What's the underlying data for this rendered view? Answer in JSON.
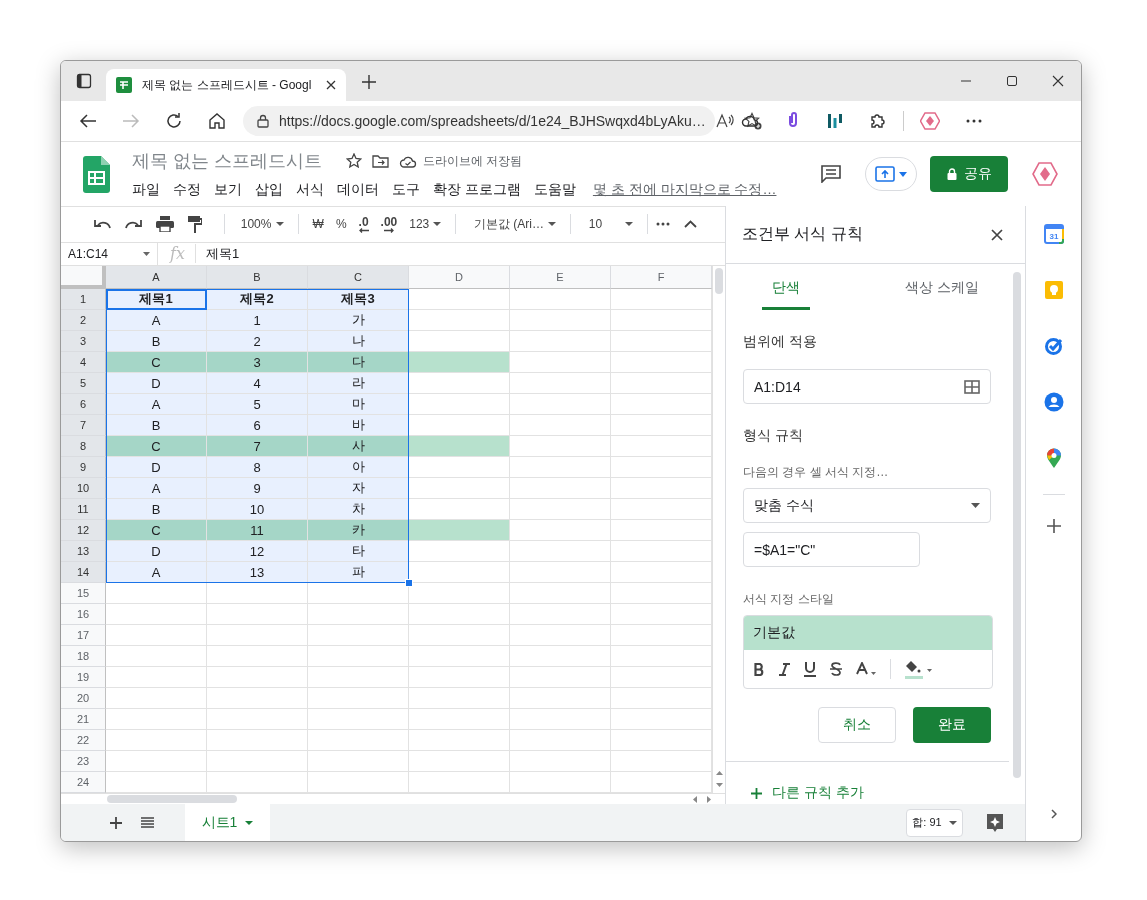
{
  "browser": {
    "tab_title": "제목 없는 스프레드시트 - Googl",
    "url": "https://docs.google.com/spreadsheets/d/1e24_BJHSwqxd4bLyAku…"
  },
  "app": {
    "doc_title": "제목 없는 스프레드시트",
    "save_status": "드라이브에 저장됨",
    "menu": [
      "파일",
      "수정",
      "보기",
      "삽입",
      "서식",
      "데이터",
      "도구",
      "확장 프로그램",
      "도움말"
    ],
    "last_edit": "몇 초 전에 마지막으로 수정…",
    "share_label": "공유"
  },
  "toolbar": {
    "zoom": "100%",
    "currency": "₩",
    "percent": "%",
    "decrease_decimal": ".0",
    "increase_decimal": ".00",
    "number_format": "123",
    "font": "기본값 (Ari…",
    "font_size": "10"
  },
  "formula_bar": {
    "name_box": "A1:C14",
    "fx": "fx",
    "content": "제목1"
  },
  "grid": {
    "columns": [
      {
        "label": "A",
        "selected": true,
        "in_rule": true
      },
      {
        "label": "B",
        "selected": true,
        "in_rule": true
      },
      {
        "label": "C",
        "selected": true,
        "in_rule": true
      },
      {
        "label": "D",
        "selected": false,
        "in_rule": true
      },
      {
        "label": "E",
        "selected": false,
        "in_rule": false
      },
      {
        "label": "F",
        "selected": false,
        "in_rule": false
      }
    ],
    "rows": [
      {
        "number": "1",
        "kind": "header",
        "selected": true,
        "highlighted": false,
        "cells": [
          "제목1",
          "제목2",
          "제목3"
        ]
      },
      {
        "number": "2",
        "kind": "data",
        "selected": true,
        "highlighted": false,
        "cells": [
          "A",
          "1",
          "가"
        ]
      },
      {
        "number": "3",
        "kind": "data",
        "selected": true,
        "highlighted": false,
        "cells": [
          "B",
          "2",
          "나"
        ]
      },
      {
        "number": "4",
        "kind": "data",
        "selected": true,
        "highlighted": true,
        "cells": [
          "C",
          "3",
          "다"
        ]
      },
      {
        "number": "5",
        "kind": "data",
        "selected": true,
        "highlighted": false,
        "cells": [
          "D",
          "4",
          "라"
        ]
      },
      {
        "number": "6",
        "kind": "data",
        "selected": true,
        "highlighted": false,
        "cells": [
          "A",
          "5",
          "마"
        ]
      },
      {
        "number": "7",
        "kind": "data",
        "selected": true,
        "highlighted": false,
        "cells": [
          "B",
          "6",
          "바"
        ]
      },
      {
        "number": "8",
        "kind": "data",
        "selected": true,
        "highlighted": true,
        "cells": [
          "C",
          "7",
          "사"
        ]
      },
      {
        "number": "9",
        "kind": "data",
        "selected": true,
        "highlighted": false,
        "cells": [
          "D",
          "8",
          "아"
        ]
      },
      {
        "number": "10",
        "kind": "data",
        "selected": true,
        "highlighted": false,
        "cells": [
          "A",
          "9",
          "자"
        ]
      },
      {
        "number": "11",
        "kind": "data",
        "selected": true,
        "highlighted": false,
        "cells": [
          "B",
          "10",
          "차"
        ]
      },
      {
        "number": "12",
        "kind": "data",
        "selected": true,
        "highlighted": true,
        "cells": [
          "C",
          "11",
          "카"
        ]
      },
      {
        "number": "13",
        "kind": "data",
        "selected": true,
        "highlighted": false,
        "cells": [
          "D",
          "12",
          "타"
        ]
      },
      {
        "number": "14",
        "kind": "data",
        "selected": true,
        "highlighted": false,
        "cells": [
          "A",
          "13",
          "파"
        ]
      },
      {
        "number": "15",
        "kind": "data",
        "selected": false,
        "highlighted": false
      },
      {
        "number": "16",
        "kind": "data",
        "selected": false,
        "highlighted": false
      },
      {
        "number": "17",
        "kind": "data",
        "selected": false,
        "highlighted": false
      },
      {
        "number": "18",
        "kind": "data",
        "selected": false,
        "highlighted": false
      },
      {
        "number": "19",
        "kind": "data",
        "selected": false,
        "highlighted": false
      },
      {
        "number": "20",
        "kind": "data",
        "selected": false,
        "highlighted": false
      },
      {
        "number": "21",
        "kind": "data",
        "selected": false,
        "highlighted": false
      },
      {
        "number": "22",
        "kind": "data",
        "selected": false,
        "highlighted": false
      },
      {
        "number": "23",
        "kind": "data",
        "selected": false,
        "highlighted": false
      },
      {
        "number": "24",
        "kind": "data",
        "selected": false,
        "highlighted": false
      }
    ]
  },
  "panel": {
    "title": "조건부 서식 규칙",
    "tabs": [
      {
        "label": "단색",
        "selected": true
      },
      {
        "label": "색상 스케일",
        "selected": false
      }
    ],
    "range_label": "범위에 적용",
    "range_value": "A1:D14",
    "rules_label": "형식 규칙",
    "condition_label": "다음의 경우 셀 서식 지정…",
    "condition_value": "맞춤 수식",
    "formula_value": "=$A1=\"C\"",
    "style_label": "서식 지정 스타일",
    "style_preview": "기본값",
    "cancel_label": "취소",
    "done_label": "완료",
    "add_rule": "다른 규칙 추가"
  },
  "sheet_bar": {
    "tabs": [
      {
        "label": "시트1",
        "selected": true
      }
    ],
    "sum": "합: 91"
  },
  "side_apps": {
    "calendar_day": "31"
  }
}
